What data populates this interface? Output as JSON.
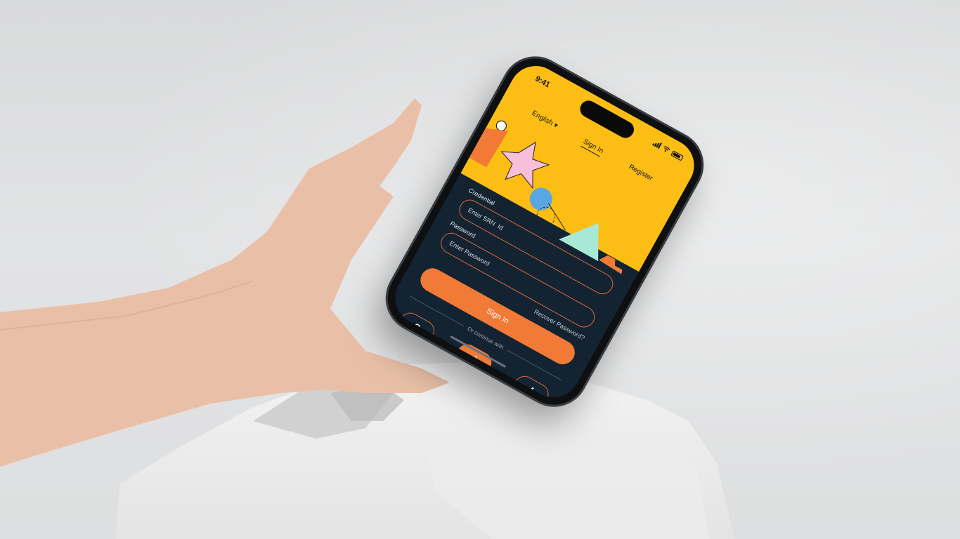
{
  "status_bar": {
    "time": "9:41"
  },
  "nav": {
    "language": "English",
    "signin_tab": "Sign In",
    "register_tab": "Register"
  },
  "form": {
    "credential_label": "Credential",
    "credential_placeholder": "Enter SRN  Id",
    "password_label": "Password",
    "password_placeholder": "Enter Password",
    "recover_link": "Recover Password?",
    "signin_button": "Sign In",
    "divider_text": "Or continue with"
  },
  "social": {
    "google_glyph": "G",
    "facebook_glyph": "f",
    "icons": [
      "google-icon",
      "apple-icon",
      "facebook-icon"
    ]
  },
  "colors": {
    "header_yellow": "#fcbd14",
    "screen_navy": "#132332",
    "accent_orange": "#f07a36"
  }
}
